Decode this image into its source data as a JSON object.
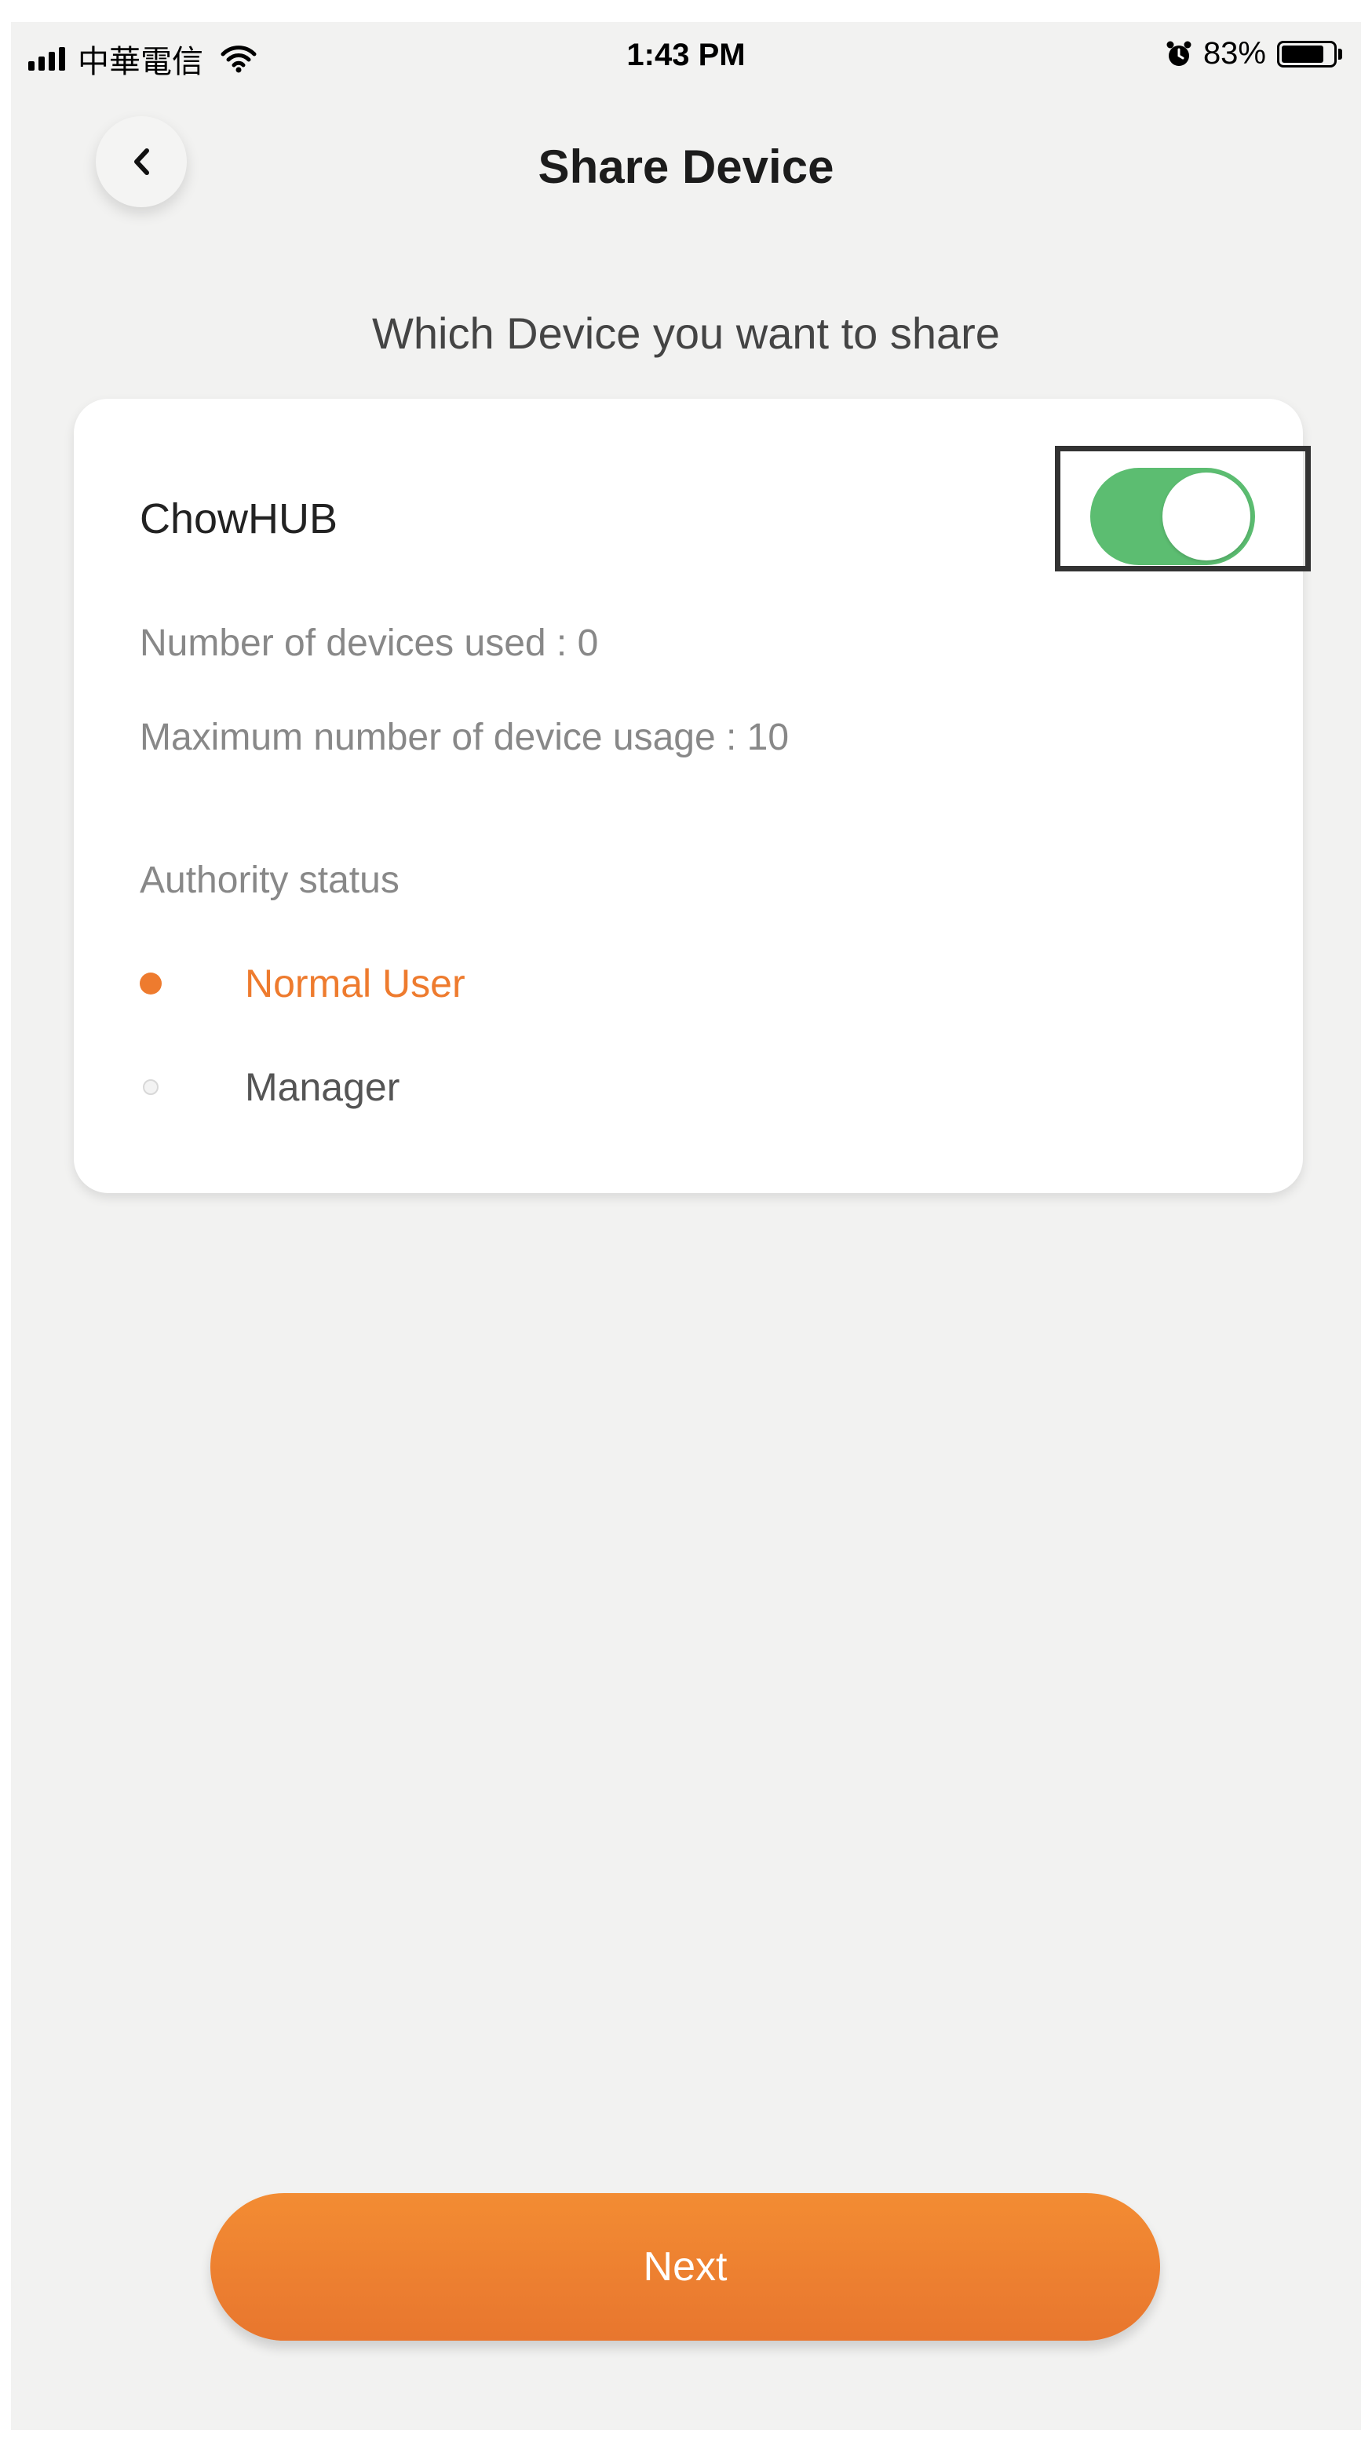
{
  "status_bar": {
    "carrier": "中華電信",
    "time": "1:43 PM",
    "battery_percent": "83%",
    "battery_level": 0.83,
    "icons": [
      "signal-icon",
      "wifi-icon",
      "alarm-icon",
      "battery-icon"
    ]
  },
  "header": {
    "title": "Share Device",
    "back_icon": "chevron-left-icon"
  },
  "subtitle": "Which Device you want to share",
  "device_card": {
    "name": "ChowHUB",
    "toggle_on": true,
    "devices_used": "Number of devices used :  0",
    "max_usage": "Maximum number of device usage : 10",
    "authority_label": "Authority status",
    "options": [
      {
        "label": "Normal User",
        "selected": true
      },
      {
        "label": "Manager",
        "selected": false
      }
    ]
  },
  "next_button": {
    "label": "Next"
  },
  "colors": {
    "accent": "#ee7b2e",
    "toggle_on": "#5cbd71",
    "background": "#f2f2f1",
    "card": "#ffffff"
  }
}
